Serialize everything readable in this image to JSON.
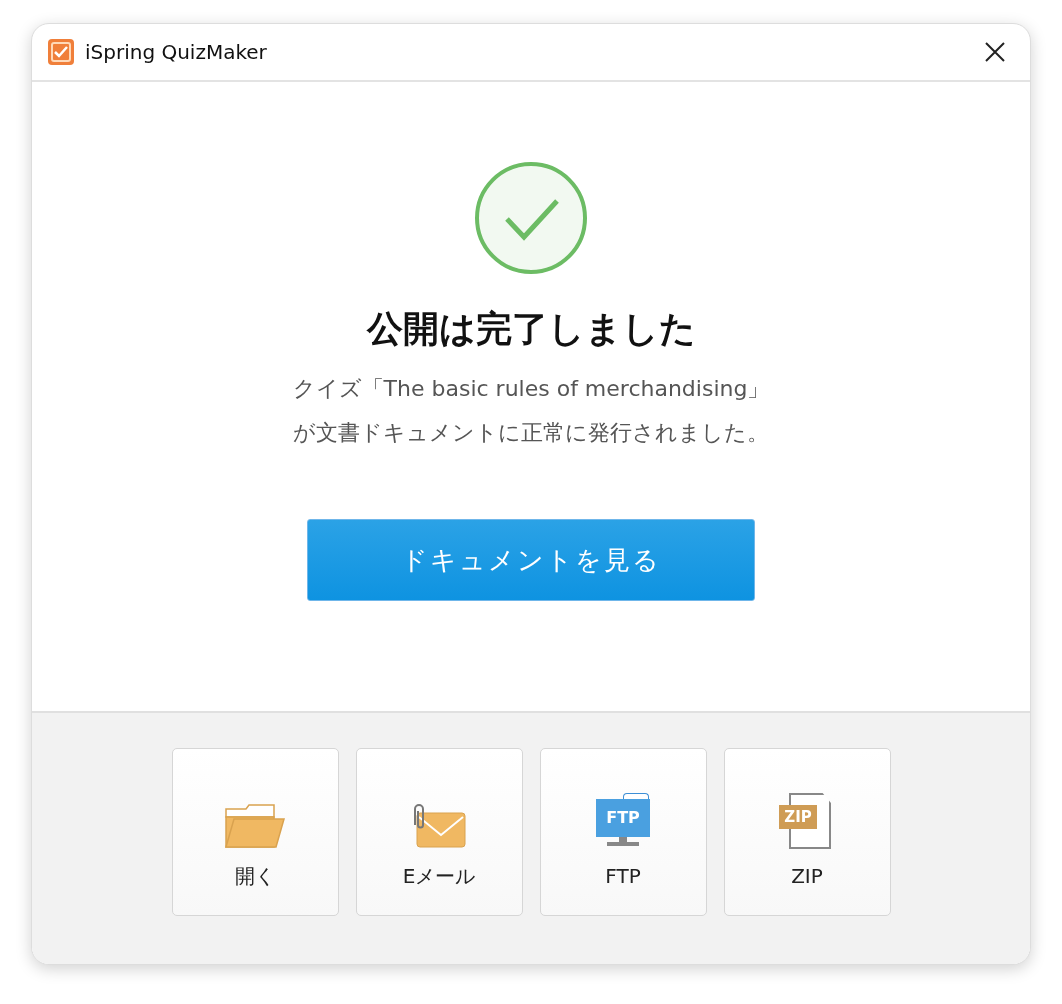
{
  "window": {
    "title": "iSpring QuizMaker"
  },
  "result": {
    "heading": "公開は完了しました",
    "message_lines": [
      "クイズ「The basic rules of merchandising」",
      "が文書ドキュメントに正常に発行されました。"
    ]
  },
  "primary_button": "ドキュメントを見る",
  "actions": [
    {
      "kind": "folder",
      "label": "開く"
    },
    {
      "kind": "email",
      "label": "Eメール"
    },
    {
      "kind": "ftp",
      "label": "FTP",
      "icon_text": "FTP"
    },
    {
      "kind": "zip",
      "label": "ZIP",
      "icon_text": "ZIP"
    }
  ]
}
